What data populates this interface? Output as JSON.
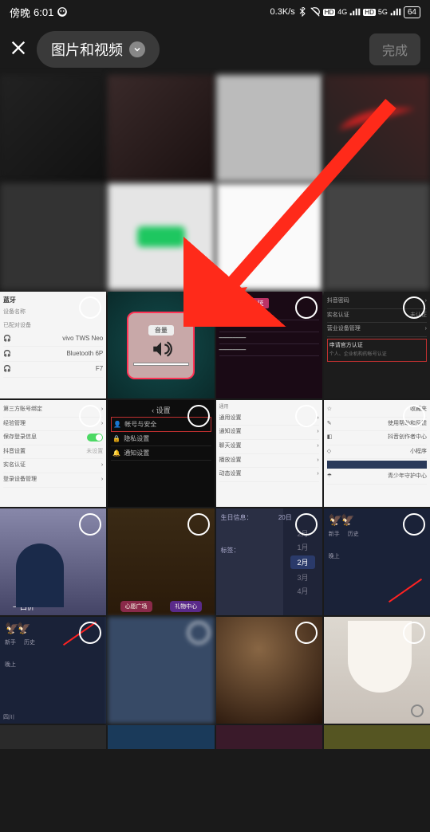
{
  "status": {
    "time_prefix": "傍晚",
    "time": "6:01",
    "net_speed": "0.3K/s",
    "hd1": "HD",
    "net1": "4G",
    "hd2": "HD",
    "net2": "5G",
    "battery": "64"
  },
  "header": {
    "dropdown_label": "图片和视频",
    "done_label": "完成"
  },
  "cells": {
    "r3c1": {
      "hdr": "蓝牙",
      "sub": "设备名称",
      "section": "已配对设备",
      "items": [
        "vivo TWS Neo",
        "Bluetooth 6P",
        "F7"
      ]
    },
    "r3c2": {
      "volume_label": "音量"
    },
    "r3c3": {
      "tag": "职业认证",
      "lines": [
        "",
        "",
        "",
        ""
      ]
    },
    "r3c4": {
      "items": [
        "抖音密码",
        "实名认证",
        "营业设备管理"
      ],
      "box_title": "申请官方认证",
      "box_sub": "个人、企业机构的帐号认证",
      "badge": "未认证"
    },
    "r4c1": {
      "items": [
        "第三方账号绑定",
        "经验管理",
        "保存登录信息",
        "抖音设置",
        "实名认证",
        "登录设备管理"
      ]
    },
    "r4c2": {
      "title": "设置",
      "items": [
        "帐号与安全",
        "隐私设置",
        "通知设置"
      ]
    },
    "r4c3": {
      "hdr": "通用",
      "items": [
        "通用设置",
        "通知设置",
        "聊天设置",
        "播放设置",
        "动态设置"
      ]
    },
    "r4c4": {
      "items": [
        "收藏夹",
        "使用帮助和反馈",
        "抖音创作者中心",
        "小程序",
        "",
        "青少年守护中心"
      ]
    },
    "r5c1": {
      "caption": "一口价"
    },
    "r5c2": {
      "btn1": "心愿广场",
      "btn2": "礼物中心"
    },
    "r5c3": {
      "label_top": "生日信息：",
      "label_bot": "标签：",
      "months": [
        "2月",
        "1月",
        "2月",
        "3月",
        "4月"
      ],
      "day": "20日"
    },
    "r5c4": {
      "tabs": [
        "新手",
        "历史"
      ],
      "sub": "晚上"
    },
    "r6c1": {
      "tabs": [
        "新手",
        "历史"
      ],
      "sub": "晚上",
      "foot": "四川"
    }
  }
}
